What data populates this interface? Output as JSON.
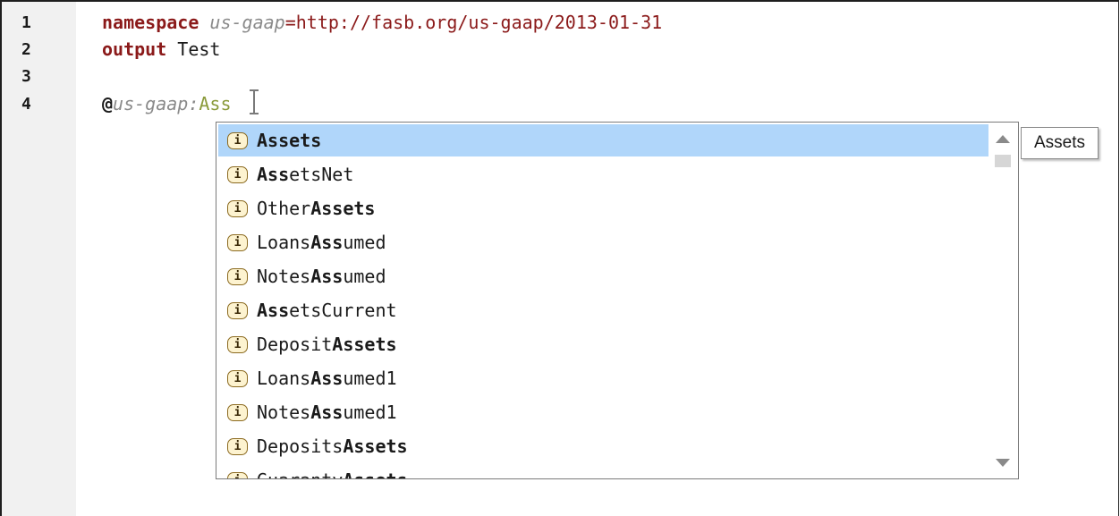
{
  "editor": {
    "line_numbers": [
      "1",
      "2",
      "3",
      "4"
    ],
    "line1": {
      "keyword": "namespace",
      "prefix": "us-gaap",
      "equals": "=",
      "url": "http://fasb.org/us-gaap/2013-01-31"
    },
    "line2": {
      "keyword": "output",
      "name": "Test"
    },
    "line4": {
      "at": "@",
      "prefix": "us-gaap",
      "colon": ":",
      "typed": "Ass"
    }
  },
  "autocomplete": {
    "icon_glyph": "i",
    "selected_index": 0,
    "items": [
      {
        "pre": "",
        "match": "Assets",
        "post": ""
      },
      {
        "pre": "",
        "match": "Ass",
        "post": "etsNet"
      },
      {
        "pre": "Other",
        "match": "Assets",
        "post": ""
      },
      {
        "pre": "Loans",
        "match": "Ass",
        "post": "umed"
      },
      {
        "pre": "Notes",
        "match": "Ass",
        "post": "umed"
      },
      {
        "pre": "",
        "match": "Ass",
        "post": "etsCurrent"
      },
      {
        "pre": "Deposit",
        "match": "Assets",
        "post": ""
      },
      {
        "pre": "Loans",
        "match": "Ass",
        "post": "umed1"
      },
      {
        "pre": "Notes",
        "match": "Ass",
        "post": "umed1"
      },
      {
        "pre": "Deposits",
        "match": "Assets",
        "post": ""
      },
      {
        "pre": "Guaranty",
        "match": "Assets",
        "post": ""
      }
    ]
  },
  "tooltip": {
    "text": "Assets"
  }
}
